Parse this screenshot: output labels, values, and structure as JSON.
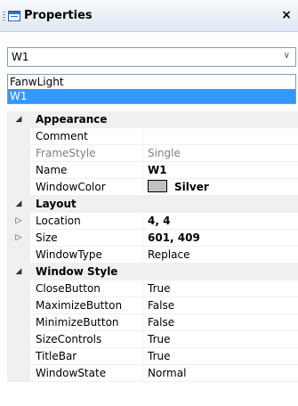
{
  "panel": {
    "title": "Properties",
    "close_glyph": "×"
  },
  "object_selector": {
    "selected": "W1",
    "options": [
      "FanwLight",
      "W1"
    ],
    "highlighted_index": 1
  },
  "grid": {
    "appearance": {
      "label": "Appearance",
      "rows": [
        {
          "name": "Comment",
          "value": ""
        },
        {
          "name": "FrameStyle",
          "value": "Single"
        },
        {
          "name": "Name",
          "value": "W1"
        },
        {
          "name": "WindowColor",
          "value": "Silver",
          "swatch_color": "#c0c0c0"
        }
      ]
    },
    "layout": {
      "label": "Layout",
      "rows": [
        {
          "name": "Location",
          "value": "4, 4"
        },
        {
          "name": "Size",
          "value": "601, 409"
        },
        {
          "name": "WindowType",
          "value": "Replace"
        }
      ]
    },
    "window_style": {
      "label": "Window Style",
      "rows": [
        {
          "name": "CloseButton",
          "value": "True"
        },
        {
          "name": "MaximizeButton",
          "value": "False"
        },
        {
          "name": "MinimizeButton",
          "value": "False"
        },
        {
          "name": "SizeControls",
          "value": "True"
        },
        {
          "name": "TitleBar",
          "value": "True"
        },
        {
          "name": "WindowState",
          "value": "Normal"
        }
      ]
    }
  }
}
